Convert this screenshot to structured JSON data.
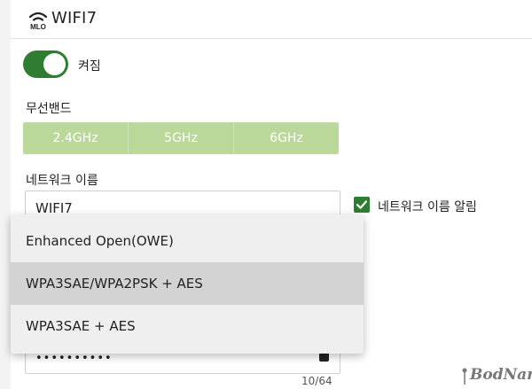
{
  "header": {
    "icon": "mlo-wifi-icon",
    "icon_text": "MLO",
    "title": "WIFI7"
  },
  "power": {
    "state": "on",
    "label": "켜짐"
  },
  "band": {
    "label": "무선밴드",
    "options": [
      "2.4GHz",
      "5GHz",
      "6GHz"
    ]
  },
  "network": {
    "label": "네트워크 이름",
    "value": "WIFI7",
    "broadcast_label": "네트워크 이름 알림",
    "broadcast_checked": true
  },
  "security": {
    "options": [
      "Enhanced Open(OWE)",
      "WPA3SAE/WPA2PSK + AES",
      "WPA3SAE + AES"
    ],
    "highlighted": "WPA3SAE/WPA2PSK + AES"
  },
  "password": {
    "masked": "••••••••••",
    "counter": "10/64"
  },
  "watermark": {
    "text": "BodNara"
  },
  "colors": {
    "accent_green": "#2f7d32",
    "band_green": "#b9d89a",
    "dropdown_bg": "#efefef",
    "dropdown_selected": "#d3d3d3"
  }
}
